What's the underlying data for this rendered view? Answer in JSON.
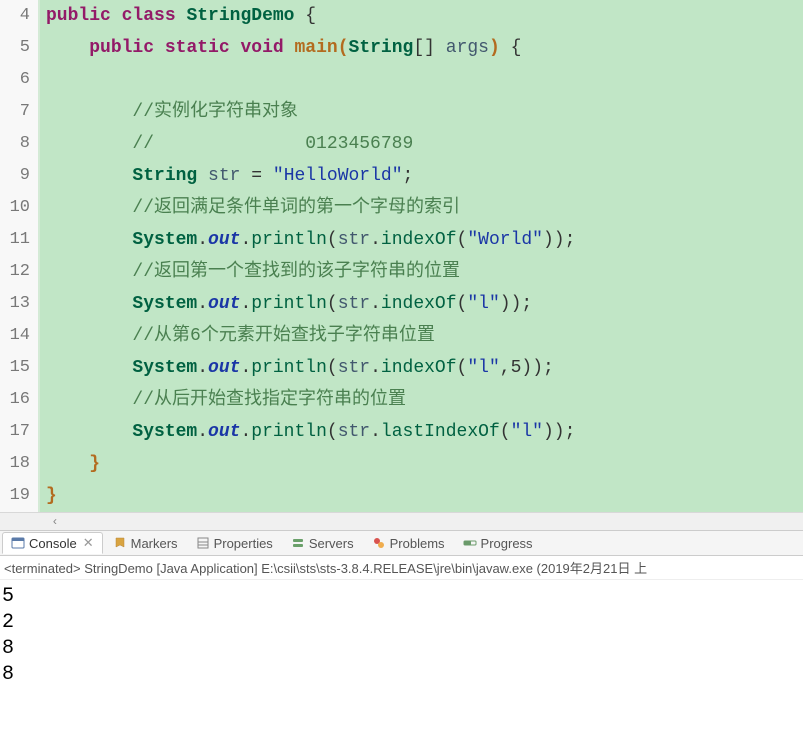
{
  "editor": {
    "lines": [
      {
        "n": 4
      },
      {
        "n": 5
      },
      {
        "n": 6
      },
      {
        "n": 7
      },
      {
        "n": 8
      },
      {
        "n": 9
      },
      {
        "n": 10
      },
      {
        "n": 11
      },
      {
        "n": 12
      },
      {
        "n": 13
      },
      {
        "n": 14
      },
      {
        "n": 15
      },
      {
        "n": 16
      },
      {
        "n": 17
      },
      {
        "n": 18
      },
      {
        "n": 19
      }
    ],
    "tokens": {
      "public": "public",
      "class": "class",
      "static": "static",
      "void": "void",
      "className": "StringDemo",
      "mainName": "main",
      "stringType": "String",
      "args": "args",
      "system": "System",
      "out": "out",
      "println": "println",
      "indexOf": "indexOf",
      "lastIndexOf": "lastIndexOf",
      "strVar": "str",
      "eq": "=",
      "helloWorld": "\"HelloWorld\"",
      "world": "\"World\"",
      "l": "\"l\"",
      "five": "5",
      "c1": "//实例化字符串对象",
      "c2": "//              0123456789",
      "c3": "//返回满足条件单词的第一个字母的索引",
      "c4": "//返回第一个查找到的该子字符串的位置",
      "c5": "//从第6个元素开始查找子字符串位置",
      "c6": "//从后开始查找指定字符串的位置"
    }
  },
  "tabs": {
    "console": "Console",
    "markers": "Markers",
    "properties": "Properties",
    "servers": "Servers",
    "problems": "Problems",
    "progress": "Progress"
  },
  "termline": "<terminated> StringDemo [Java Application] E:\\csii\\sts\\sts-3.8.4.RELEASE\\jre\\bin\\javaw.exe (2019年2月21日 上",
  "output": [
    "5",
    "2",
    "8",
    "8"
  ]
}
